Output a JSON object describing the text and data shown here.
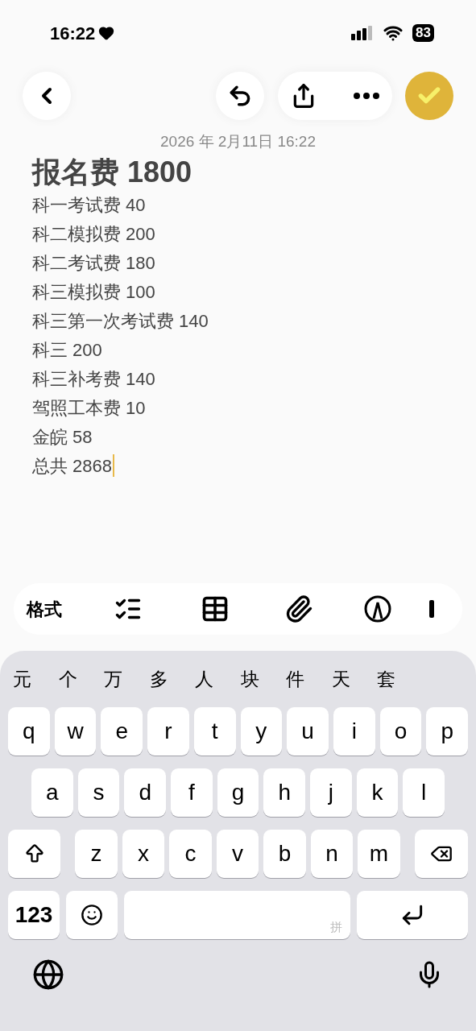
{
  "status_bar": {
    "time": "16:22",
    "battery": "83"
  },
  "note": {
    "date": "2026 年 2月11日 16:22",
    "title": "报名费 1800",
    "lines": [
      "科一考试费 40",
      "科二模拟费 200",
      "科二考试费 180",
      "科三模拟费 100",
      "科三第一次考试费 140",
      "科三 200",
      "科三补考费 140",
      "驾照工本费 10",
      "金皖 58",
      "总共 2868"
    ]
  },
  "toolbar": {
    "format_label": "格式"
  },
  "keyboard": {
    "candidates": [
      "元",
      "个",
      "万",
      "多",
      "人",
      "块",
      "件",
      "天",
      "套"
    ],
    "rows": [
      [
        "q",
        "w",
        "e",
        "r",
        "t",
        "y",
        "u",
        "i",
        "o",
        "p"
      ],
      [
        "a",
        "s",
        "d",
        "f",
        "g",
        "h",
        "j",
        "k",
        "l"
      ],
      [
        "z",
        "x",
        "c",
        "v",
        "b",
        "n",
        "m"
      ]
    ],
    "numbers_key": "123",
    "space_hint": "拼"
  }
}
